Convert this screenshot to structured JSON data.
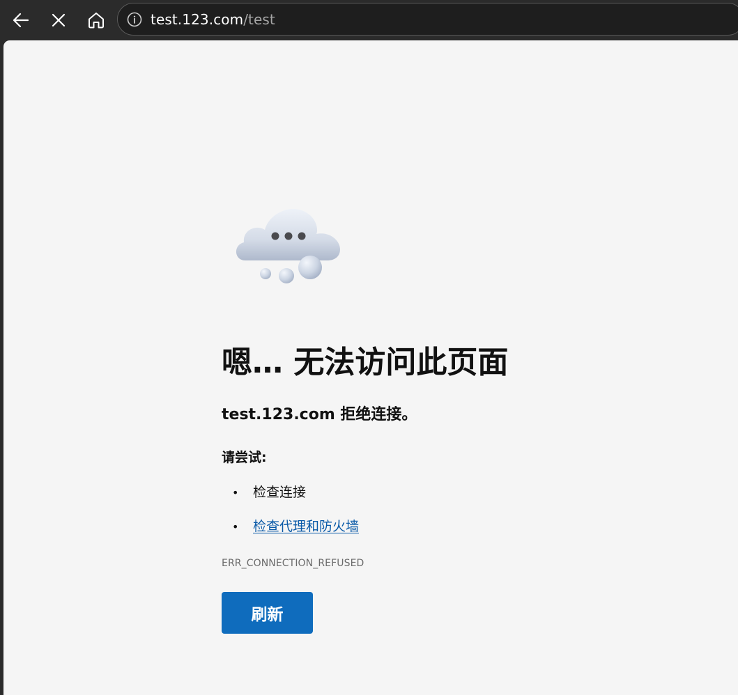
{
  "browser": {
    "toolbar": {
      "back_icon": "arrow-left-icon",
      "stop_icon": "close-icon",
      "home_icon": "home-icon"
    },
    "address": {
      "info_icon": "info-icon",
      "host": "test.123.com",
      "path": "/test"
    }
  },
  "error_page": {
    "illustration": "cloud-icon",
    "title": "嗯… 无法访问此页面",
    "subtitle": "test.123.com 拒绝连接。",
    "try_label": "请尝试:",
    "suggestions": [
      {
        "bullet": "•",
        "text": "检查连接",
        "is_link": false
      },
      {
        "bullet": "•",
        "text": "检查代理和防火墙",
        "is_link": true
      }
    ],
    "error_code": "ERR_CONNECTION_REFUSED",
    "refresh_label": "刷新"
  },
  "colors": {
    "toolbar_bg": "#2b2b2b",
    "page_bg": "#f5f5f5",
    "link": "#0a5aa8",
    "button_bg": "#0f6cbd"
  }
}
